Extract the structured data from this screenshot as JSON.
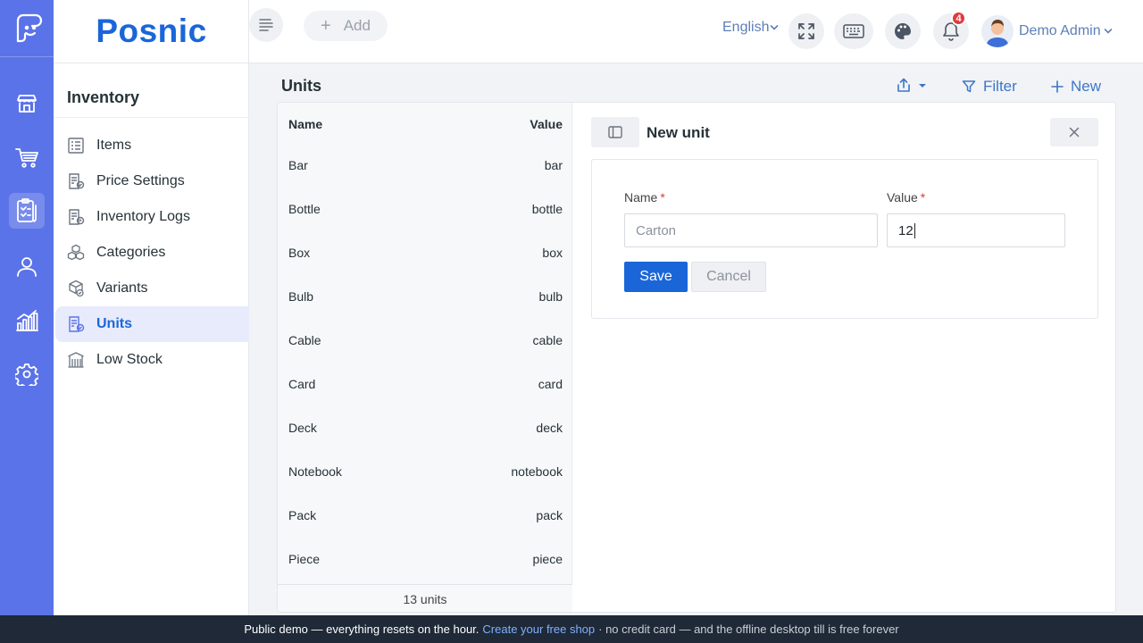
{
  "brand": {
    "name": "Posnic"
  },
  "sidebar": {
    "section": "Inventory",
    "items": [
      {
        "label": "Items"
      },
      {
        "label": "Price Settings"
      },
      {
        "label": "Inventory Logs"
      },
      {
        "label": "Categories"
      },
      {
        "label": "Variants"
      },
      {
        "label": "Units"
      },
      {
        "label": "Low Stock"
      }
    ],
    "active_item": "Units"
  },
  "topbar": {
    "add_label": "Add",
    "language": "English",
    "notification_count": "4",
    "user_name": "Demo Admin"
  },
  "page": {
    "title": "Units",
    "filter_label": "Filter",
    "new_label": "New"
  },
  "list": {
    "columns": [
      "Name",
      "Value"
    ],
    "rows": [
      {
        "name": "Bar",
        "value": "bar"
      },
      {
        "name": "Bottle",
        "value": "bottle"
      },
      {
        "name": "Box",
        "value": "box"
      },
      {
        "name": "Bulb",
        "value": "bulb"
      },
      {
        "name": "Cable",
        "value": "cable"
      },
      {
        "name": "Card",
        "value": "card"
      },
      {
        "name": "Deck",
        "value": "deck"
      },
      {
        "name": "Notebook",
        "value": "notebook"
      },
      {
        "name": "Pack",
        "value": "pack"
      },
      {
        "name": "Piece",
        "value": "piece"
      }
    ],
    "footer": "13 units"
  },
  "form": {
    "title": "New unit",
    "name_label": "Name",
    "name_placeholder": "Carton",
    "value_label": "Value",
    "value_current": "12",
    "required_mark": "*",
    "save_label": "Save",
    "cancel_label": "Cancel"
  },
  "banner": {
    "text_before": "Public demo — everything resets on the hour.",
    "link": "Create your free shop",
    "text_after": "· no credit card — and the offline desktop till is free forever"
  },
  "colors": {
    "rail": "#5b73e8",
    "brand": "#1a66d9",
    "primary_button": "#1a66d9",
    "badge": "#e0393e",
    "banner": "#1f2937"
  },
  "icons": {
    "rail": [
      "app-logo-icon",
      "store-icon",
      "cart-icon",
      "inventory-clipboard-icon",
      "user-icon",
      "chart-icon",
      "settings-gear-icon"
    ],
    "topbar": [
      "menu-toggle-icon",
      "fullscreen-icon",
      "keyboard-icon",
      "palette-icon",
      "bell-icon"
    ]
  }
}
